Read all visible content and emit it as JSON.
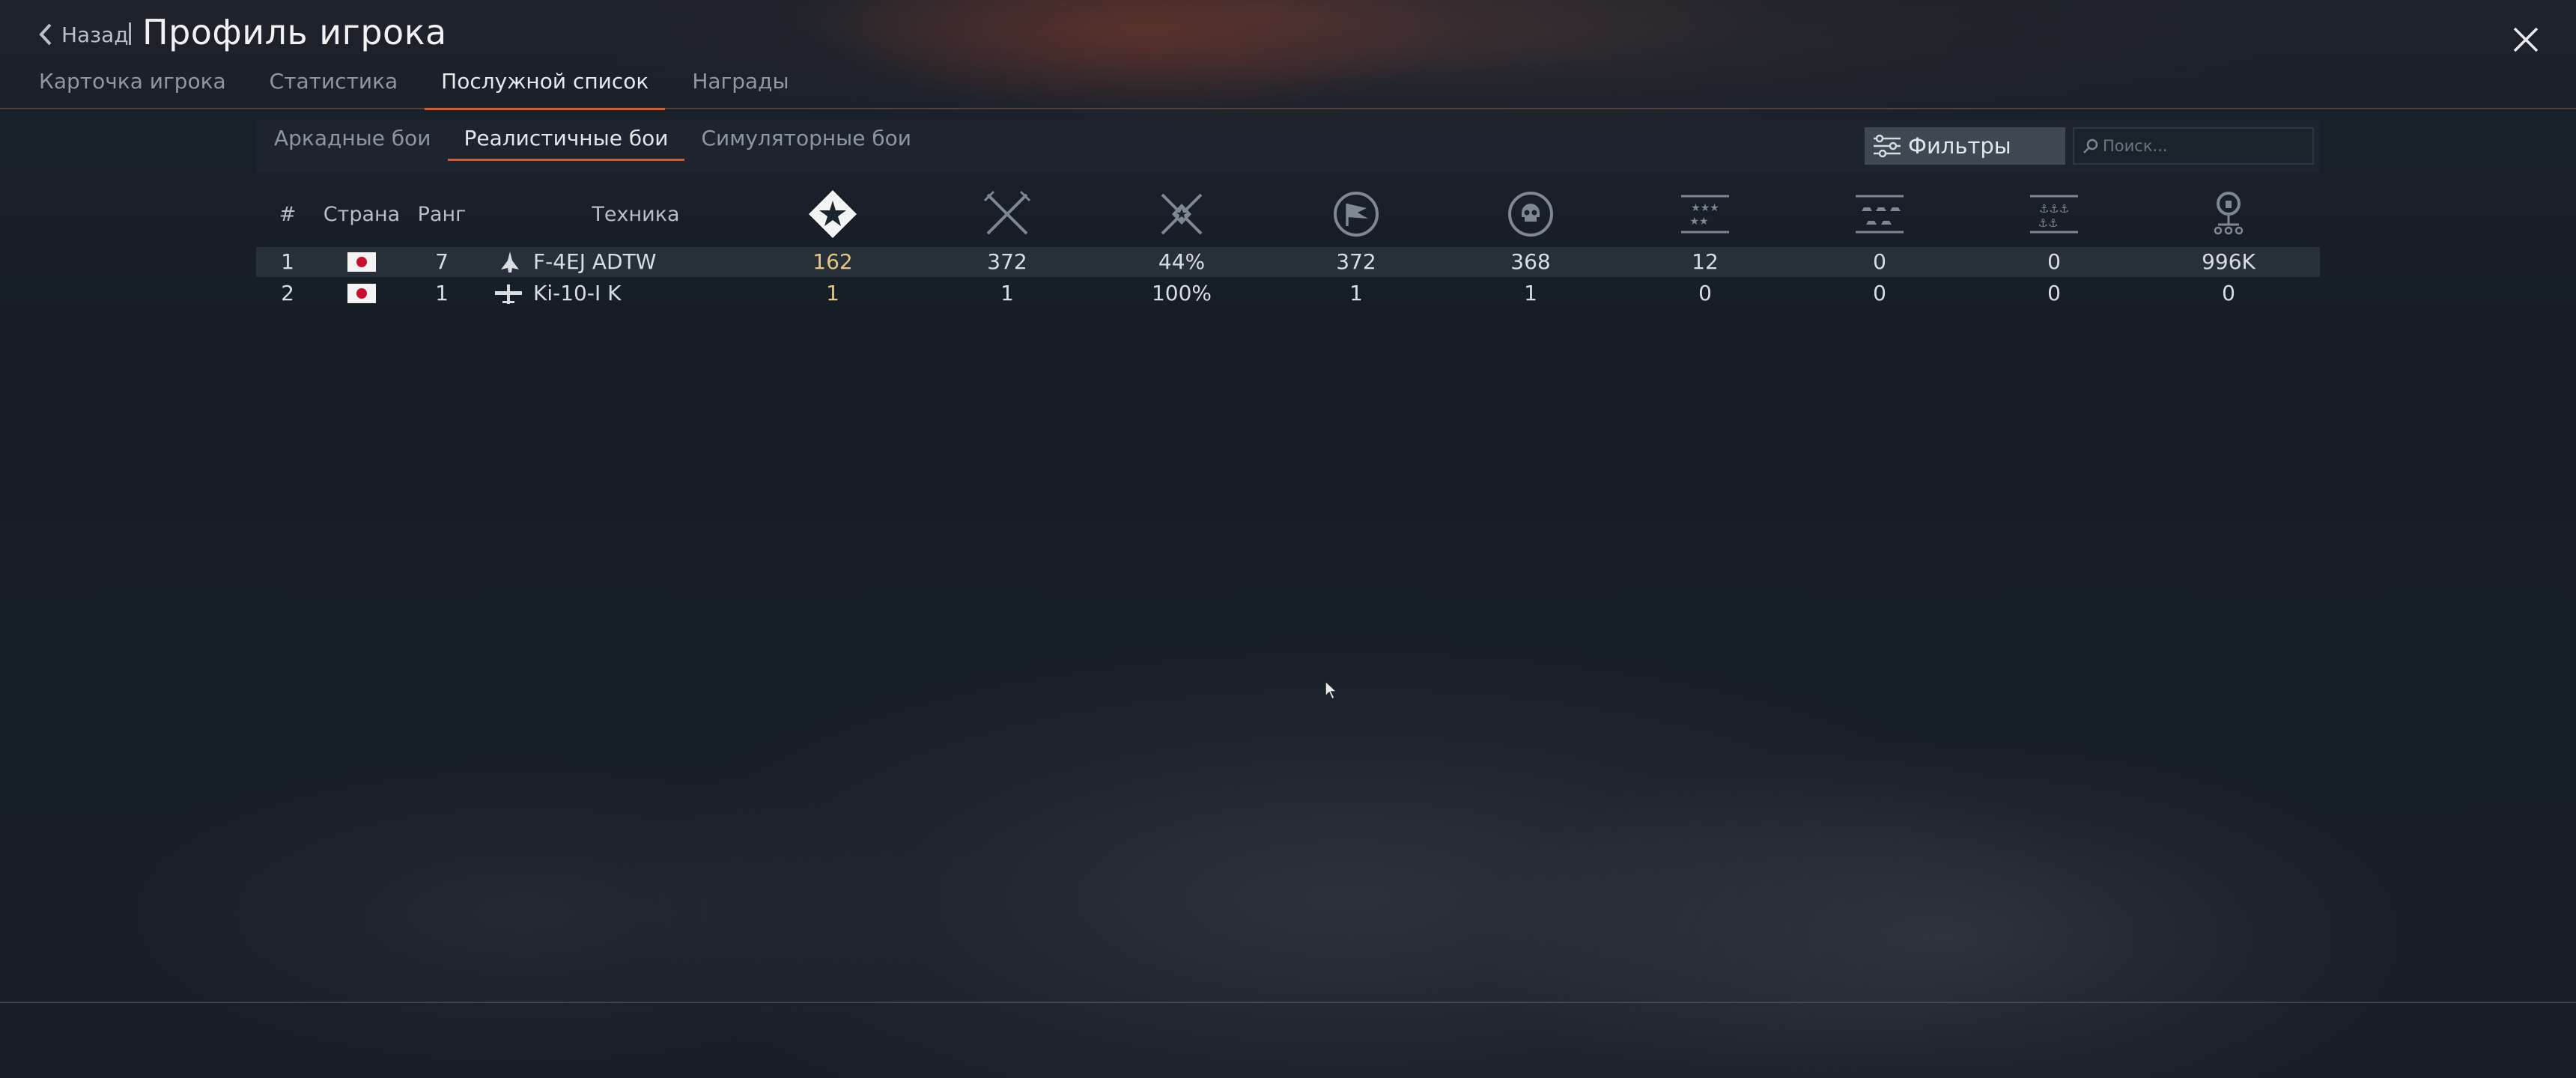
{
  "header": {
    "back_label": "Назад",
    "title": "Профиль игрока",
    "tabs": [
      {
        "label": "Карточка игрока",
        "active": false
      },
      {
        "label": "Статистика",
        "active": false
      },
      {
        "label": "Послужной список",
        "active": true
      },
      {
        "label": "Награды",
        "active": false
      }
    ]
  },
  "mode_tabs": [
    {
      "label": "Аркадные бои",
      "active": false
    },
    {
      "label": "Реалистичные бои",
      "active": true
    },
    {
      "label": "Симуляторные бои",
      "active": false
    }
  ],
  "filters": {
    "label": "Фильтры",
    "search_placeholder": "Поиск..."
  },
  "table": {
    "columns": {
      "index": "#",
      "country": "Страна",
      "rank": "Ранг",
      "vehicle": "Техника",
      "icon_columns": [
        "victories-icon",
        "battles-icon",
        "win-rate-icon",
        "respawns-icon",
        "deaths-icon",
        "air-kills-icon",
        "ground-kills-icon",
        "naval-kills-icon",
        "research-points-icon"
      ]
    },
    "rows": [
      {
        "index": "1",
        "country": "Japan",
        "rank": "7",
        "vehicle_type": "jet-icon",
        "vehicle": "F-4EJ ADTW",
        "values": [
          "162",
          "372",
          "44%",
          "372",
          "368",
          "12",
          "0",
          "0",
          "996K"
        ]
      },
      {
        "index": "2",
        "country": "Japan",
        "rank": "1",
        "vehicle_type": "prop-plane-icon",
        "vehicle": "Ki-10-I K",
        "values": [
          "1",
          "1",
          "100%",
          "1",
          "1",
          "0",
          "0",
          "0",
          "0"
        ]
      }
    ]
  },
  "colors": {
    "accent": "#d95a2b",
    "gold": "#e3c782",
    "flag_red": "#c8102e"
  }
}
